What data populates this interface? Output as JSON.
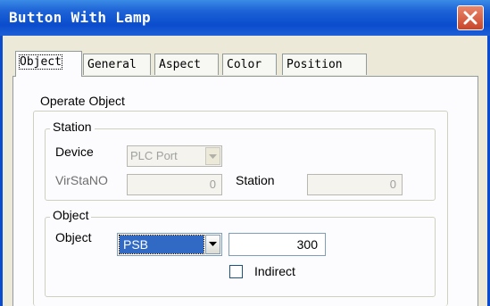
{
  "window": {
    "title": "Button With Lamp"
  },
  "tabs": [
    {
      "label": "Object"
    },
    {
      "label": "General"
    },
    {
      "label": "Aspect"
    },
    {
      "label": "Color"
    },
    {
      "label": "Position"
    }
  ],
  "operate_object": {
    "legend": "Operate Object",
    "station": {
      "legend": "Station",
      "device_label": "Device",
      "device_value": "PLC Port",
      "virsta_label": "VirStaNO",
      "virsta_value": "0",
      "station_label": "Station",
      "station_value": "0"
    },
    "object": {
      "legend": "Object",
      "object_label": "Object",
      "object_type": "PSB",
      "object_address": "300",
      "indirect_label": "Indirect",
      "indirect_checked": false
    }
  },
  "colors": {
    "title_bar": "#0a4ccd",
    "selection": "#316ac5",
    "close_button": "#c8452a"
  }
}
